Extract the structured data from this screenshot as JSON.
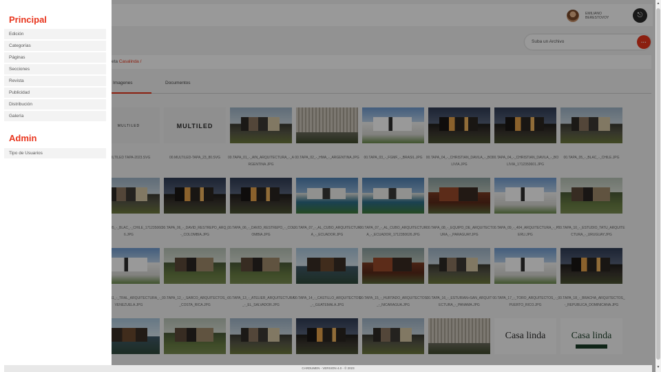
{
  "header": {
    "user_name": "EMILIANO BERESTOVOY",
    "logout_icon": "logout-icon"
  },
  "upload": {
    "label": "Suba un Archivo",
    "button_icon": "more-icon",
    "button_glyph": "···"
  },
  "breadcrumb": {
    "prefix": "eta",
    "current": "Casalinda /"
  },
  "tabs": [
    {
      "label": "Imagenes",
      "active": true
    },
    {
      "label": "Documentos",
      "active": false
    }
  ],
  "files": [
    {
      "caption": "MULTILED TAPA-2023.SVG",
      "logo": "MULTILED"
    },
    {
      "caption": "00.MULTILED-TAPA_23_80.SVG",
      "logo": "MULTILED"
    },
    {
      "caption": "00.TAPA_01_-_AIN_ARQUITECTURA_-_ARGENTINA.JPG"
    },
    {
      "caption": "00.TAPA_02_-_HMA_-_ARGENTINA.JPG"
    },
    {
      "caption": "00.TAPA_03_-_FGMF_-_BRASIL.JPG"
    },
    {
      "caption": "00.TAPA_04_-_CHRISTIAN_DAVILA_-_BOLIVIA.JPG"
    },
    {
      "caption": "00.TAPA_04_-_CHRISTIAN_DAVILA_-_BOLIVIA_1712350601.JPG"
    },
    {
      "caption": "00.TAPA_05_-_BLAC_-_CHILE.JPG"
    },
    {
      "caption": "00.TAPA_05_-_BLAC_-_CHILE_1712350606.JPG"
    },
    {
      "caption": "00.TAPA_06_-_DAVID_RESTREPO_ARQ_-_COLOMBIA.JPG"
    },
    {
      "caption": "00.TAPA_06_-_DAVID_RESTREPO_-_COLOMBIA.JPG"
    },
    {
      "caption": "00.TAPA_07_-_AL_CUBO_ARQUITECTURA_-_ECUADOR.JPG"
    },
    {
      "caption": "00.TAPA_07_-_AL_CUBO_ARQUITECTURA_-_ECUADOR_1712350626.JPG"
    },
    {
      "caption": "00.TAPA_08_-_EQUIPO_DE_ARQUITECTURA_-_PARAGUAY.JPG"
    },
    {
      "caption": "00.TAPA_09_-_404_ARQUITECTURA_-_PERU.JPG"
    },
    {
      "caption": "00.TAPA_10_-_ESTUDIO_TATU_ARQUITECTURA_-_URUGUAY.JPG"
    },
    {
      "caption": "00.TAPA_11_-_TRAL_ARQUITECTURA_-_VENEZUELA.JPG"
    },
    {
      "caption": "00.TAPA_12_-_SARCO_ARQUITECTOS_-_COSTA_RICA.JPG"
    },
    {
      "caption": "00.TAPA_13_-_ATELIER_ARQUITECTURA_-_EL_SALVADOR.JPG"
    },
    {
      "caption": "00.TAPA_14_-_CASTILLO_ARQUITECTOS_-_GUATEMALA.JPG"
    },
    {
      "caption": "00.TAPA_15_-_HURTADO_ARQUITECTOS_-_NICARAGUA.JPG"
    },
    {
      "caption": "00.TAPA_16_-_ESTURIAN+SAN_ARQUITECTURA_-_PANAMA.JPG"
    },
    {
      "caption": "00.TAPA_17_-_TORO_ARQUITECTOS_-_PUERTO_RICO.JPG"
    },
    {
      "caption": "00.TAPA_18_-_BRACHA_ARQUITECTOS_-_REPUBLICA_DOMINICANA.JPG"
    },
    {
      "caption": ""
    },
    {
      "caption": ""
    },
    {
      "caption": ""
    },
    {
      "caption": ""
    },
    {
      "caption": ""
    },
    {
      "caption": ""
    },
    {
      "caption": "",
      "logo": "Casa linda"
    },
    {
      "caption": "",
      "logo": "Casa linda"
    }
  ],
  "sidebar": {
    "principal_title": "Principal",
    "principal_items": [
      "Edición",
      "Categorías",
      "Páginas",
      "Secciones",
      "Revista",
      "Publicidad",
      "Distribución",
      "Galería"
    ],
    "admin_title": "Admin",
    "admin_items": [
      "Tipo de Usuarios"
    ]
  },
  "footer": {
    "text": "CARDUMEN - VERSION 4.0 - © 2023"
  },
  "colors": {
    "accent": "#e8341c",
    "overlay": "rgba(0,0,0,0.40)"
  }
}
